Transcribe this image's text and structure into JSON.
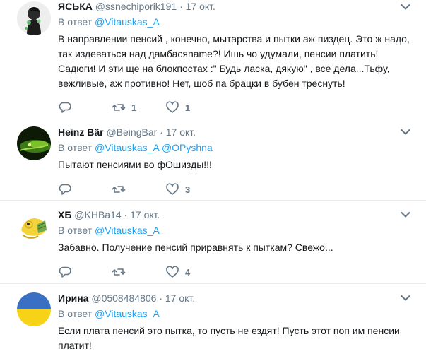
{
  "tweets": [
    {
      "name": "ЯСЬКА",
      "handle": "@ssnechiporik191",
      "dot": "·",
      "time": "17 окт.",
      "reply_prefix": "В ответ",
      "mentions": [
        "@Vitauskas_A"
      ],
      "text": "В направлении пенсий , конечно, мытарства и пытки аж пиздец. Это ж надо, так издеваться над дамбасяname?! Ишь чо удумали, пенсии платить! Садюги! И эти ще на блокпостах :\" Будь ласка, дякую\" , все дела...Тьфу, вежливые, аж противно! Нет, шоб па брацки в бубен треснуть!",
      "replies": "",
      "retweets": "1",
      "likes": "1"
    },
    {
      "name": "Heinz Bär",
      "handle": "@BeingBar",
      "dot": "·",
      "time": "17 окт.",
      "reply_prefix": "В ответ",
      "mentions": [
        "@Vitauskas_A",
        "@OPyshna"
      ],
      "text": "Пытают пенсиями во фОшизды!!!",
      "replies": "",
      "retweets": "",
      "likes": "3"
    },
    {
      "name": "ХБ",
      "handle": "@KHBa14",
      "dot": "·",
      "time": "17 окт.",
      "reply_prefix": "В ответ",
      "mentions": [
        "@Vitauskas_A"
      ],
      "text": "Забавно. Получение пенсий приравнять к пыткам? Свежо...",
      "replies": "",
      "retweets": "",
      "likes": "4"
    },
    {
      "name": "Ирина",
      "handle": "@0508484806",
      "dot": "·",
      "time": "17 окт.",
      "reply_prefix": "В ответ",
      "mentions": [
        "@Vitauskas_A"
      ],
      "text": "Если плата пенсий это пытка, то пусть не ездят! Пусть этот поп им пенсии платит!",
      "replies": "",
      "retweets": "",
      "likes": ""
    }
  ],
  "icons": {
    "reply": "reply-icon",
    "retweet": "retweet-icon",
    "like": "heart-icon",
    "caret": "chevron-down-icon"
  },
  "colors": {
    "text": "#14171a",
    "secondary": "#657786",
    "link": "#1da1f2",
    "border": "#e6ecf0",
    "flag_blue": "#3a70c4",
    "flag_yellow": "#f6d317"
  }
}
